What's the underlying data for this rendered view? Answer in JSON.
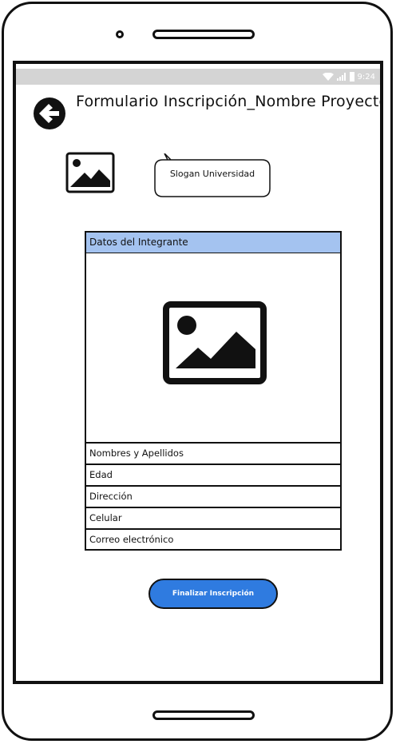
{
  "status_bar": {
    "time": "9:24"
  },
  "header": {
    "title": "Formulario Inscripción_Nombre Proyecto"
  },
  "branding": {
    "slogan": "Slogan Universidad"
  },
  "card": {
    "header": "Datos del Integrante",
    "fields": [
      "Nombres y Apellidos",
      "Edad",
      "Dirección",
      "Celular",
      "Correo electrónico"
    ]
  },
  "actions": {
    "finish_label": "Finalizar Inscripción"
  },
  "colors": {
    "accent": "#2f7be0",
    "card_header": "#a4c3f0",
    "status_bar": "#d4d4d4"
  }
}
